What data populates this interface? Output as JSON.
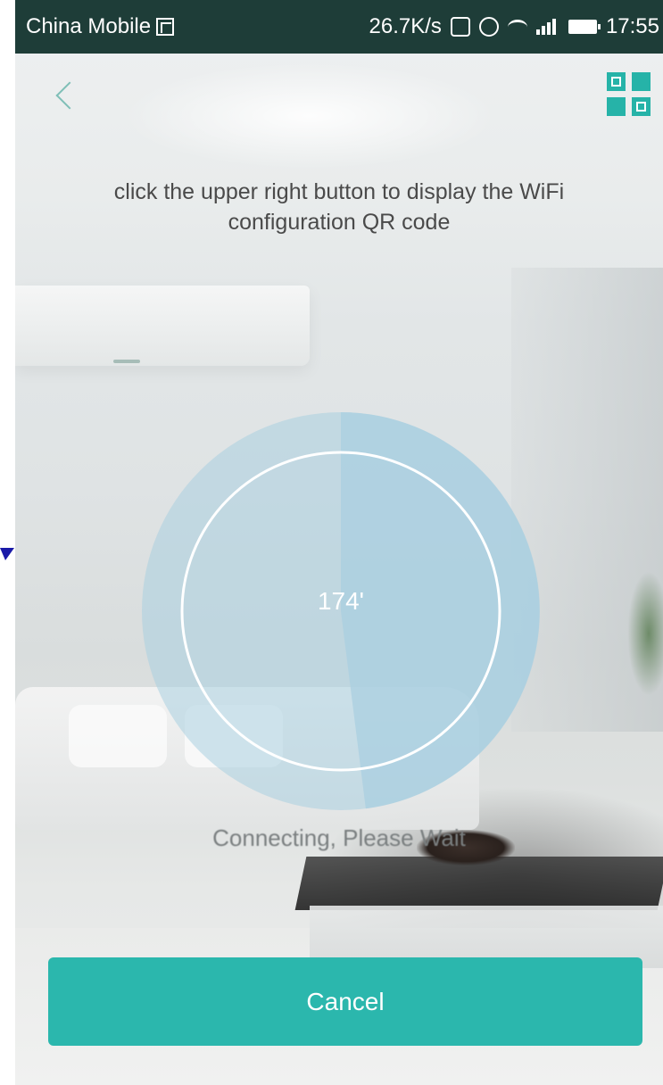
{
  "status_bar": {
    "carrier": "China Mobile",
    "network_speed": "26.7K/s",
    "time": "17:55",
    "icons": [
      "sim-icon",
      "sync-icon",
      "alarm-icon",
      "wifi-icon",
      "signal-icon",
      "battery-icon"
    ]
  },
  "header": {
    "back_icon": "chevron-left-icon",
    "qr_icon": "qr-code-icon"
  },
  "instruction": "click the upper right button to display the WiFi configuration QR code",
  "progress": {
    "value_label": "174'",
    "fraction": 0.48,
    "status_text": "Connecting, Please Wait"
  },
  "cancel_label": "Cancel",
  "colors": {
    "accent": "#2bb7ad",
    "status_bar": "#1e3d38",
    "dial_fill": "#aacfe0"
  }
}
